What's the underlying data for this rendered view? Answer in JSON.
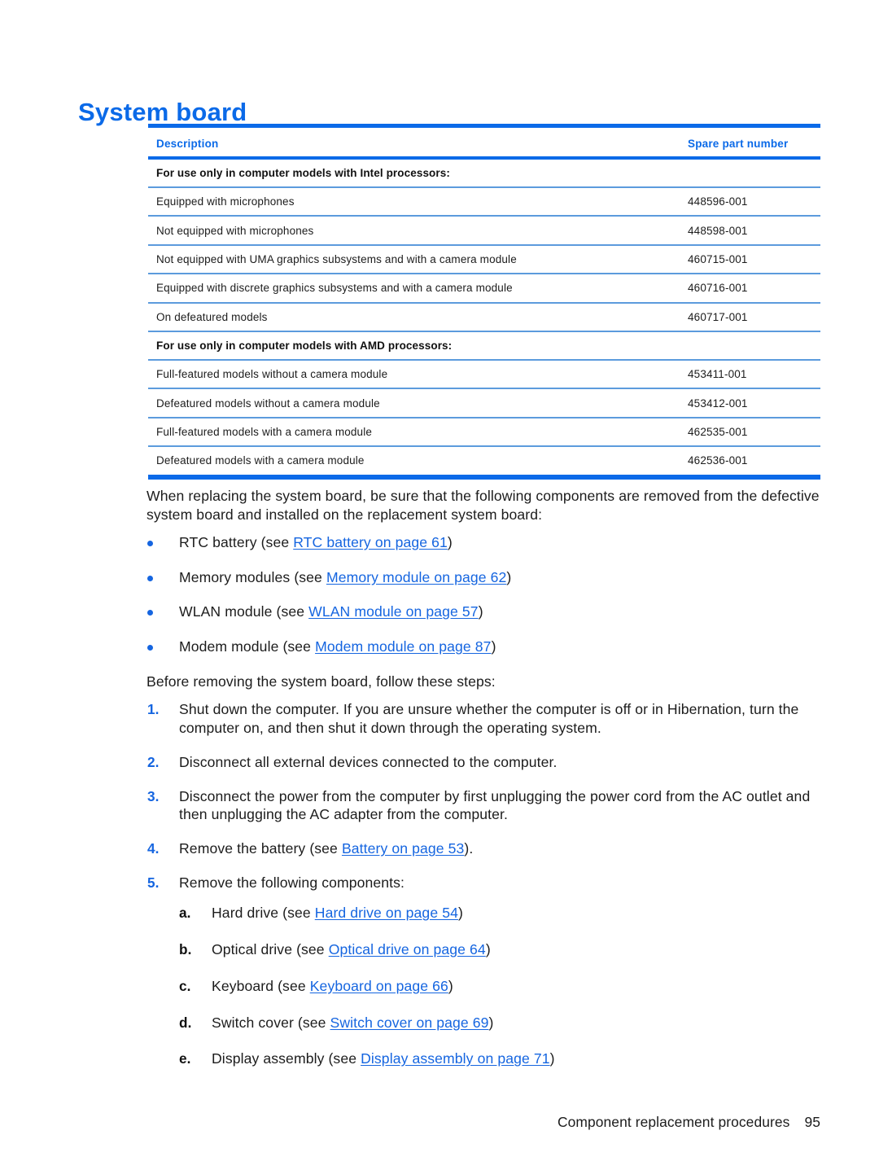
{
  "page": {
    "title": "System board"
  },
  "table": {
    "headers": {
      "description": "Description",
      "spare_part_number": "Spare part number"
    },
    "sections": [
      {
        "heading": "For use only in computer models with Intel processors:",
        "rows": [
          {
            "description": "Equipped with microphones",
            "part": "448596-001"
          },
          {
            "description": "Not equipped with microphones",
            "part": "448598-001"
          },
          {
            "description": "Not equipped with UMA graphics subsystems and with a camera module",
            "part": "460715-001"
          },
          {
            "description": "Equipped with discrete graphics subsystems and with a camera module",
            "part": "460716-001"
          },
          {
            "description": "On defeatured models",
            "part": "460717-001"
          }
        ]
      },
      {
        "heading": "For use only in computer models with AMD processors:",
        "rows": [
          {
            "description": "Full-featured models without a camera module",
            "part": "453411-001"
          },
          {
            "description": "Defeatured models without a camera module",
            "part": "453412-001"
          },
          {
            "description": "Full-featured models with a camera module",
            "part": "462535-001"
          },
          {
            "description": "Defeatured models with a camera module",
            "part": "462536-001"
          }
        ]
      }
    ]
  },
  "body": {
    "intro_paragraph": "When replacing the system board, be sure that the following components are removed from the defective system board and installed on the replacement system board:",
    "components": [
      {
        "pre": "RTC battery (see ",
        "link": "RTC battery on page 61",
        "post": ")"
      },
      {
        "pre": "Memory modules (see ",
        "link": "Memory module on page 62",
        "post": ")"
      },
      {
        "pre": "WLAN module (see ",
        "link": "WLAN module on page 57",
        "post": ")"
      },
      {
        "pre": "Modem module (see ",
        "link": "Modem module on page 87",
        "post": ")"
      }
    ],
    "steps_paragraph": "Before removing the system board, follow these steps:",
    "steps": [
      {
        "marker": "1.",
        "pre": "Shut down the computer. If you are unsure whether the computer is off or in Hibernation, turn the computer on, and then shut it down through the operating system.",
        "link": "",
        "post": ""
      },
      {
        "marker": "2.",
        "pre": "Disconnect all external devices connected to the computer.",
        "link": "",
        "post": ""
      },
      {
        "marker": "3.",
        "pre": "Disconnect the power from the computer by first unplugging the power cord from the AC outlet and then unplugging the AC adapter from the computer.",
        "link": "",
        "post": ""
      },
      {
        "marker": "4.",
        "pre": "Remove the battery (see ",
        "link": "Battery on page 53",
        "post": ")."
      },
      {
        "marker": "5.",
        "pre": "Remove the following components:",
        "link": "",
        "post": ""
      }
    ],
    "substeps": [
      {
        "marker": "a.",
        "pre": "Hard drive (see ",
        "link": "Hard drive on page 54",
        "post": ")"
      },
      {
        "marker": "b.",
        "pre": "Optical drive (see ",
        "link": "Optical drive on page 64",
        "post": ")"
      },
      {
        "marker": "c.",
        "pre": "Keyboard (see ",
        "link": "Keyboard on page 66",
        "post": ")"
      },
      {
        "marker": "d.",
        "pre": "Switch cover (see ",
        "link": "Switch cover on page 69",
        "post": ")"
      },
      {
        "marker": "e.",
        "pre": "Display assembly (see ",
        "link": "Display assembly on page 71",
        "post": ")"
      }
    ]
  },
  "footer": {
    "chapter": "Component replacement procedures",
    "page_number": "95"
  },
  "colors": {
    "accent_blue": "#0b6ae8",
    "rule_blue": "#5c9bdd",
    "link_blue": "#1565e0",
    "text": "#1c1c1c"
  }
}
